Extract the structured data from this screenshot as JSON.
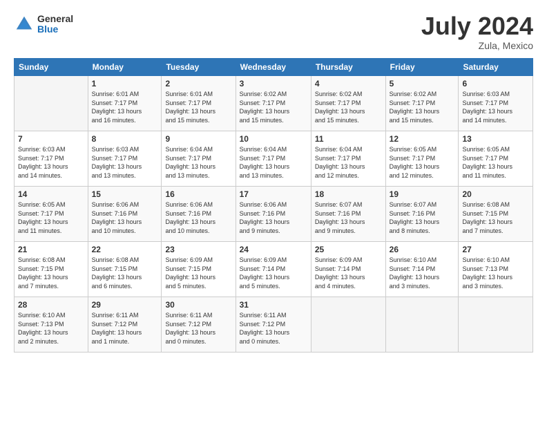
{
  "header": {
    "logo_general": "General",
    "logo_blue": "Blue",
    "month_title": "July 2024",
    "location": "Zula, Mexico"
  },
  "days_of_week": [
    "Sunday",
    "Monday",
    "Tuesday",
    "Wednesday",
    "Thursday",
    "Friday",
    "Saturday"
  ],
  "weeks": [
    [
      {
        "day": "",
        "info": ""
      },
      {
        "day": "1",
        "info": "Sunrise: 6:01 AM\nSunset: 7:17 PM\nDaylight: 13 hours\nand 16 minutes."
      },
      {
        "day": "2",
        "info": "Sunrise: 6:01 AM\nSunset: 7:17 PM\nDaylight: 13 hours\nand 15 minutes."
      },
      {
        "day": "3",
        "info": "Sunrise: 6:02 AM\nSunset: 7:17 PM\nDaylight: 13 hours\nand 15 minutes."
      },
      {
        "day": "4",
        "info": "Sunrise: 6:02 AM\nSunset: 7:17 PM\nDaylight: 13 hours\nand 15 minutes."
      },
      {
        "day": "5",
        "info": "Sunrise: 6:02 AM\nSunset: 7:17 PM\nDaylight: 13 hours\nand 15 minutes."
      },
      {
        "day": "6",
        "info": "Sunrise: 6:03 AM\nSunset: 7:17 PM\nDaylight: 13 hours\nand 14 minutes."
      }
    ],
    [
      {
        "day": "7",
        "info": "Sunrise: 6:03 AM\nSunset: 7:17 PM\nDaylight: 13 hours\nand 14 minutes."
      },
      {
        "day": "8",
        "info": "Sunrise: 6:03 AM\nSunset: 7:17 PM\nDaylight: 13 hours\nand 13 minutes."
      },
      {
        "day": "9",
        "info": "Sunrise: 6:04 AM\nSunset: 7:17 PM\nDaylight: 13 hours\nand 13 minutes."
      },
      {
        "day": "10",
        "info": "Sunrise: 6:04 AM\nSunset: 7:17 PM\nDaylight: 13 hours\nand 13 minutes."
      },
      {
        "day": "11",
        "info": "Sunrise: 6:04 AM\nSunset: 7:17 PM\nDaylight: 13 hours\nand 12 minutes."
      },
      {
        "day": "12",
        "info": "Sunrise: 6:05 AM\nSunset: 7:17 PM\nDaylight: 13 hours\nand 12 minutes."
      },
      {
        "day": "13",
        "info": "Sunrise: 6:05 AM\nSunset: 7:17 PM\nDaylight: 13 hours\nand 11 minutes."
      }
    ],
    [
      {
        "day": "14",
        "info": "Sunrise: 6:05 AM\nSunset: 7:17 PM\nDaylight: 13 hours\nand 11 minutes."
      },
      {
        "day": "15",
        "info": "Sunrise: 6:06 AM\nSunset: 7:16 PM\nDaylight: 13 hours\nand 10 minutes."
      },
      {
        "day": "16",
        "info": "Sunrise: 6:06 AM\nSunset: 7:16 PM\nDaylight: 13 hours\nand 10 minutes."
      },
      {
        "day": "17",
        "info": "Sunrise: 6:06 AM\nSunset: 7:16 PM\nDaylight: 13 hours\nand 9 minutes."
      },
      {
        "day": "18",
        "info": "Sunrise: 6:07 AM\nSunset: 7:16 PM\nDaylight: 13 hours\nand 9 minutes."
      },
      {
        "day": "19",
        "info": "Sunrise: 6:07 AM\nSunset: 7:16 PM\nDaylight: 13 hours\nand 8 minutes."
      },
      {
        "day": "20",
        "info": "Sunrise: 6:08 AM\nSunset: 7:15 PM\nDaylight: 13 hours\nand 7 minutes."
      }
    ],
    [
      {
        "day": "21",
        "info": "Sunrise: 6:08 AM\nSunset: 7:15 PM\nDaylight: 13 hours\nand 7 minutes."
      },
      {
        "day": "22",
        "info": "Sunrise: 6:08 AM\nSunset: 7:15 PM\nDaylight: 13 hours\nand 6 minutes."
      },
      {
        "day": "23",
        "info": "Sunrise: 6:09 AM\nSunset: 7:15 PM\nDaylight: 13 hours\nand 5 minutes."
      },
      {
        "day": "24",
        "info": "Sunrise: 6:09 AM\nSunset: 7:14 PM\nDaylight: 13 hours\nand 5 minutes."
      },
      {
        "day": "25",
        "info": "Sunrise: 6:09 AM\nSunset: 7:14 PM\nDaylight: 13 hours\nand 4 minutes."
      },
      {
        "day": "26",
        "info": "Sunrise: 6:10 AM\nSunset: 7:14 PM\nDaylight: 13 hours\nand 3 minutes."
      },
      {
        "day": "27",
        "info": "Sunrise: 6:10 AM\nSunset: 7:13 PM\nDaylight: 13 hours\nand 3 minutes."
      }
    ],
    [
      {
        "day": "28",
        "info": "Sunrise: 6:10 AM\nSunset: 7:13 PM\nDaylight: 13 hours\nand 2 minutes."
      },
      {
        "day": "29",
        "info": "Sunrise: 6:11 AM\nSunset: 7:12 PM\nDaylight: 13 hours\nand 1 minute."
      },
      {
        "day": "30",
        "info": "Sunrise: 6:11 AM\nSunset: 7:12 PM\nDaylight: 13 hours\nand 0 minutes."
      },
      {
        "day": "31",
        "info": "Sunrise: 6:11 AM\nSunset: 7:12 PM\nDaylight: 13 hours\nand 0 minutes."
      },
      {
        "day": "",
        "info": ""
      },
      {
        "day": "",
        "info": ""
      },
      {
        "day": "",
        "info": ""
      }
    ]
  ]
}
